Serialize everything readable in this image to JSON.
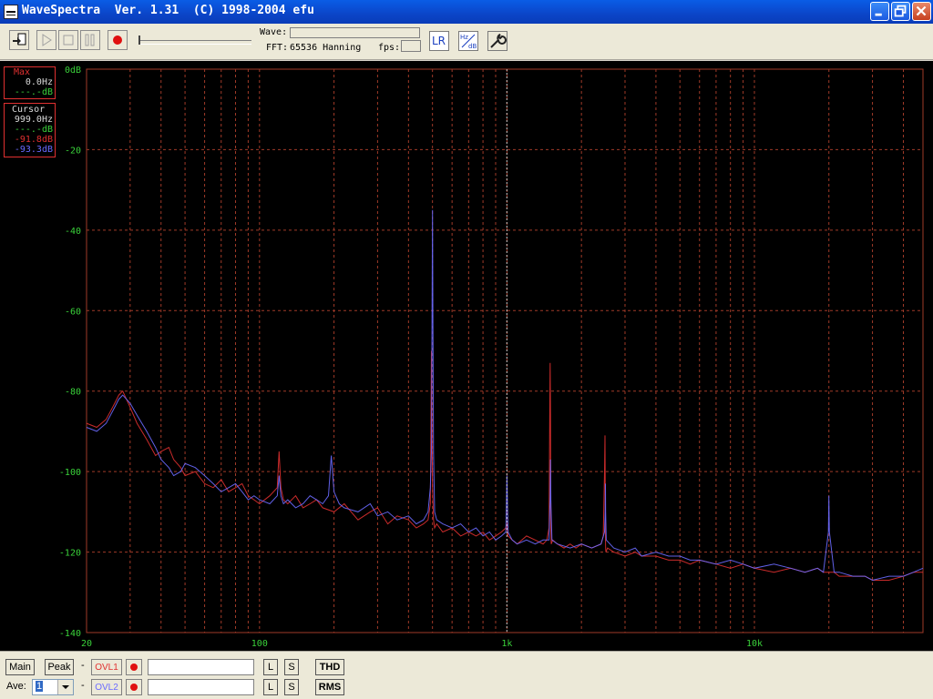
{
  "window": {
    "title": "WaveSpectra  Ver. 1.31  (C) 1998-2004 efu"
  },
  "toolbar": {
    "wave_label": "Wave:",
    "fft_label": "FFT:",
    "fft_value": "65536 Hanning",
    "fps_label": "fps:",
    "lr_label": "LR",
    "hz_db_top": "Hz",
    "hz_db_bottom": "dB"
  },
  "readout": {
    "max_title": "Max",
    "max_freq": "0.0Hz",
    "max_level": "---.-dB",
    "cursor_title": "Cursor",
    "cursor_freq": "999.0Hz",
    "cursor_level_green": "---.-dB",
    "cursor_level_red": "-91.8dB",
    "cursor_level_blue": "-93.3dB"
  },
  "colors": {
    "ch_left": "#e03030",
    "ch_right": "#6a6aff",
    "grid": "#a03a28",
    "axis_label": "#3ad23a",
    "max_border": "#e03030",
    "cursor_line": "#c8c8c8",
    "green_text": "#3ad23a"
  },
  "chart_data": {
    "type": "line",
    "xscale": "log",
    "xlim": [
      20,
      48000
    ],
    "ylim": [
      -140,
      0
    ],
    "xticks": [
      {
        "value": 20,
        "label": "20"
      },
      {
        "value": 100,
        "label": "100"
      },
      {
        "value": 1000,
        "label": "1k"
      },
      {
        "value": 10000,
        "label": "10k"
      }
    ],
    "yticks": [
      {
        "value": 0,
        "label": "0dB"
      },
      {
        "value": -20,
        "label": "-20"
      },
      {
        "value": -40,
        "label": "-40"
      },
      {
        "value": -60,
        "label": "-60"
      },
      {
        "value": -80,
        "label": "-80"
      },
      {
        "value": -100,
        "label": "-100"
      },
      {
        "value": -120,
        "label": "-120"
      },
      {
        "value": -140,
        "label": "-140"
      }
    ],
    "cursor_x": 999,
    "grid": true,
    "series": [
      {
        "color": "#e03030",
        "x": [
          20,
          22,
          24,
          25,
          26,
          27,
          28,
          30,
          32,
          35,
          38,
          40,
          43,
          45,
          48,
          50,
          55,
          60,
          65,
          70,
          75,
          80,
          85,
          90,
          95,
          100,
          110,
          118,
          120,
          122,
          125,
          130,
          140,
          150,
          160,
          170,
          180,
          200,
          220,
          250,
          280,
          300,
          330,
          360,
          400,
          430,
          460,
          480,
          490,
          495,
          500,
          505,
          510,
          520,
          550,
          600,
          650,
          700,
          750,
          800,
          850,
          900,
          950,
          990,
          1000,
          1010,
          1050,
          1100,
          1200,
          1300,
          1400,
          1450,
          1480,
          1490,
          1495,
          1500,
          1505,
          1510,
          1530,
          1600,
          1700,
          1800,
          1900,
          2000,
          2200,
          2400,
          2450,
          2480,
          2490,
          2495,
          2500,
          2505,
          2510,
          2550,
          2700,
          3000,
          3300,
          3500,
          4000,
          4500,
          5000,
          5500,
          6000,
          7000,
          8000,
          9000,
          10000,
          12000,
          14000,
          16000,
          18000,
          19000,
          20000,
          21000,
          22000,
          25000,
          28000,
          30000,
          35000,
          40000,
          44000,
          48000
        ],
        "y": [
          -88,
          -89,
          -87,
          -85,
          -83,
          -81,
          -80,
          -84,
          -88,
          -92,
          -96,
          -95,
          -94,
          -97,
          -99,
          -101,
          -100,
          -103,
          -104,
          -102,
          -105,
          -104,
          -103,
          -106,
          -107,
          -108,
          -106,
          -104,
          -95,
          -104,
          -107,
          -108,
          -106,
          -109,
          -108,
          -107,
          -109,
          -110,
          -108,
          -112,
          -110,
          -109,
          -113,
          -111,
          -112,
          -114,
          -113,
          -112,
          -108,
          -70,
          -104,
          -112,
          -114,
          -113,
          -115,
          -114,
          -116,
          -115,
          -116,
          -115,
          -117,
          -116,
          -115,
          -114,
          -113,
          -116,
          -117,
          -118,
          -116,
          -117,
          -118,
          -117,
          -114,
          -85,
          -73,
          -86,
          -114,
          -118,
          -117,
          -118,
          -119,
          -118,
          -119,
          -118,
          -119,
          -118,
          -116,
          -100,
          -91,
          -100,
          -116,
          -119,
          -120,
          -119,
          -120,
          -121,
          -120,
          -121,
          -121,
          -122,
          -122,
          -123,
          -122,
          -123,
          -124,
          -123,
          -124,
          -125,
          -124,
          -125,
          -124,
          -125,
          -125,
          -125,
          -126,
          -126,
          -126,
          -127,
          -127,
          -126,
          -125,
          -125
        ]
      },
      {
        "color": "#6a6aff",
        "x": [
          20,
          22,
          24,
          25,
          26,
          27,
          28,
          30,
          32,
          35,
          38,
          40,
          43,
          45,
          48,
          50,
          55,
          60,
          65,
          70,
          75,
          80,
          85,
          90,
          95,
          100,
          110,
          118,
          120,
          122,
          125,
          130,
          140,
          150,
          160,
          170,
          180,
          190,
          195,
          200,
          210,
          220,
          250,
          280,
          300,
          330,
          360,
          400,
          430,
          460,
          480,
          490,
          495,
          498,
          500,
          502,
          505,
          510,
          520,
          550,
          600,
          650,
          700,
          750,
          800,
          850,
          900,
          950,
          990,
          995,
          1000,
          1005,
          1010,
          1050,
          1100,
          1200,
          1300,
          1400,
          1480,
          1495,
          1500,
          1505,
          1520,
          1600,
          1800,
          2000,
          2200,
          2400,
          2480,
          2495,
          2500,
          2505,
          2520,
          2700,
          3000,
          3300,
          3500,
          4000,
          4500,
          5000,
          5500,
          6000,
          7000,
          8000,
          9000,
          10000,
          12000,
          14000,
          16000,
          18000,
          19000,
          19900,
          20000,
          20100,
          21000,
          22000,
          25000,
          28000,
          30000,
          35000,
          40000,
          44000,
          48000
        ],
        "y": [
          -89,
          -90,
          -88,
          -86,
          -84,
          -82,
          -81,
          -83,
          -86,
          -90,
          -94,
          -97,
          -99,
          -101,
          -100,
          -98,
          -99,
          -101,
          -103,
          -105,
          -104,
          -103,
          -105,
          -107,
          -106,
          -107,
          -108,
          -106,
          -101,
          -106,
          -108,
          -107,
          -109,
          -108,
          -106,
          -107,
          -108,
          -106,
          -96,
          -105,
          -108,
          -109,
          -110,
          -108,
          -111,
          -110,
          -112,
          -111,
          -113,
          -112,
          -110,
          -104,
          -95,
          -60,
          -35,
          -60,
          -95,
          -110,
          -112,
          -113,
          -114,
          -113,
          -115,
          -114,
          -116,
          -115,
          -117,
          -116,
          -115,
          -108,
          -101,
          -108,
          -115,
          -117,
          -118,
          -117,
          -118,
          -117,
          -117,
          -106,
          -97,
          -107,
          -117,
          -118,
          -119,
          -118,
          -119,
          -118,
          -115,
          -110,
          -103,
          -110,
          -117,
          -119,
          -120,
          -119,
          -121,
          -120,
          -121,
          -121,
          -122,
          -122,
          -123,
          -122,
          -123,
          -124,
          -123,
          -124,
          -125,
          -124,
          -125,
          -115,
          -106,
          -115,
          -125,
          -125,
          -126,
          -126,
          -127,
          -126,
          -126,
          -125,
          -124
        ]
      }
    ]
  },
  "bottom": {
    "main_label": "Main",
    "peak_label": "Peak",
    "dash1": "-",
    "dash2": "-",
    "ovl1_label": "OVL1",
    "ovl2_label": "OVL2",
    "ave_label": "Ave:",
    "ave_value": "1",
    "l_label": "L",
    "s_label": "S",
    "thd_label": "THD",
    "rms_label": "RMS"
  }
}
